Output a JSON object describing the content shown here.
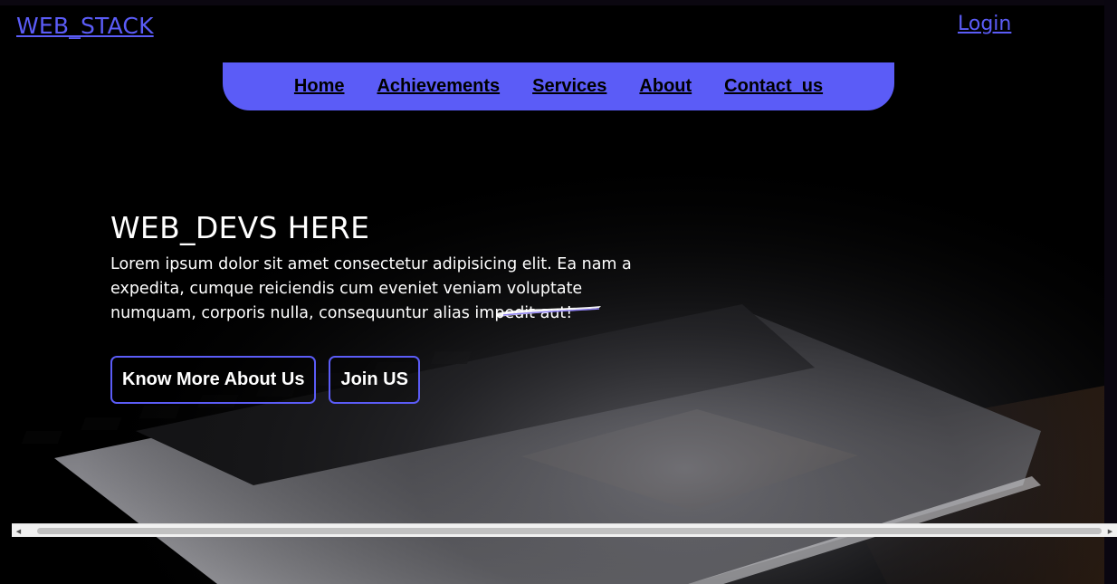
{
  "brand": {
    "logo": "WEB_STACK",
    "login": "Login"
  },
  "nav": {
    "items": [
      {
        "label": "Home"
      },
      {
        "label": "Achievements"
      },
      {
        "label": "Services"
      },
      {
        "label": "About"
      },
      {
        "label": "Contact_us"
      }
    ]
  },
  "hero": {
    "title": "WEB_DEVS HERE",
    "text": "Lorem ipsum dolor sit amet consectetur adipisicing elit. Ea nam a expedita, cumque reiciendis cum eveniet veniam voluptate numquam, corporis nulla, consequuntur alias impedit aut!",
    "buttons": {
      "know_more": "Know More About Us",
      "join": "Join US"
    }
  },
  "colors": {
    "accent": "#5b5cf7",
    "background": "#000000",
    "text": "#ffffff"
  },
  "icons": {
    "scroll_left": "triangle-left-icon",
    "scroll_right": "triangle-right-icon"
  }
}
